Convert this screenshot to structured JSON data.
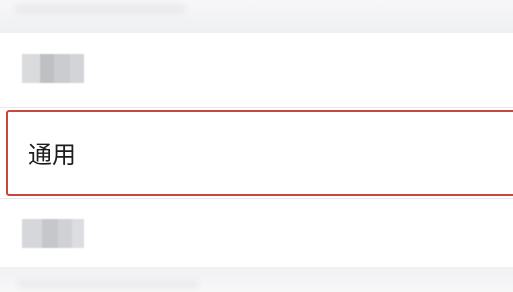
{
  "settings_list": {
    "selected_item": {
      "label": "通用"
    },
    "blurred_items": [
      {
        "name": "redacted-item-above"
      },
      {
        "name": "redacted-item-below"
      }
    ]
  },
  "colors": {
    "selection_border": "#c9463d",
    "page_background": "#f3f4f6",
    "row_background": "#ffffff",
    "text": "#1d1d1f"
  }
}
